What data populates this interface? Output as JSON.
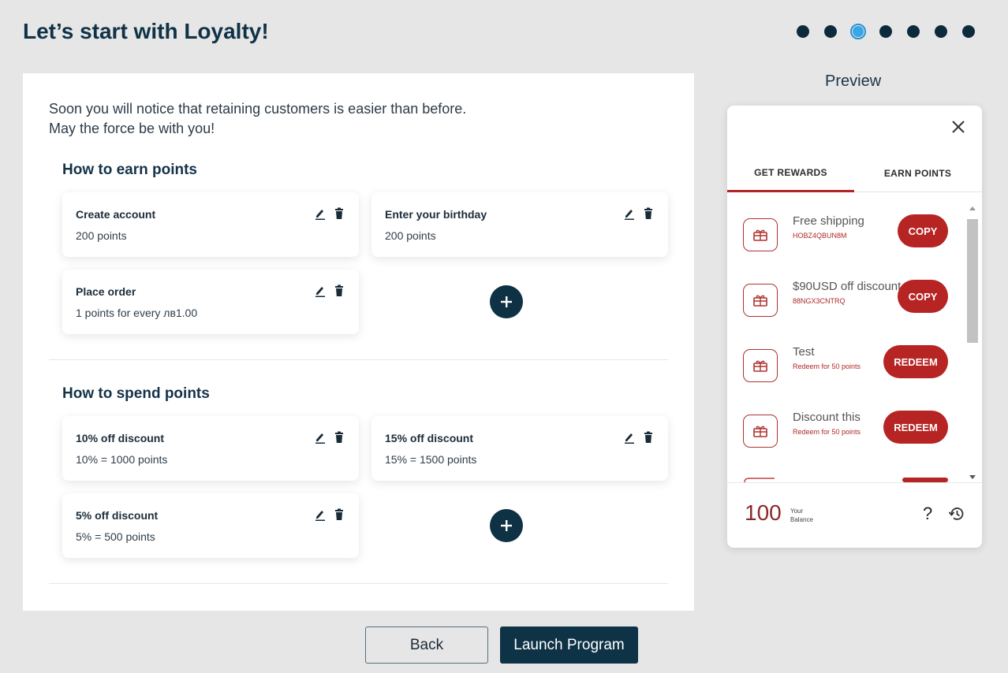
{
  "header": {
    "title": "Let’s start with Loyalty!",
    "steps_total": 7,
    "steps_active": 3
  },
  "main": {
    "intro_line1": "Soon you will notice that retaining customers is easier than before.",
    "intro_line2": "May the force be with you!",
    "earn": {
      "title": "How to earn points",
      "items": [
        {
          "name": "Create account",
          "value": "200 points"
        },
        {
          "name": "Enter your birthday",
          "value": "200 points"
        },
        {
          "name": "Place order",
          "value": "1 points for every лв1.00"
        }
      ]
    },
    "spend": {
      "title": "How to spend points",
      "items": [
        {
          "name": "10% off discount",
          "value": "10% = 1000 points"
        },
        {
          "name": "15% off discount",
          "value": "15% = 1500 points"
        },
        {
          "name": "5% off discount",
          "value": "5% = 500 points"
        }
      ]
    }
  },
  "buttons": {
    "back": "Back",
    "launch": "Launch Program"
  },
  "preview": {
    "label": "Preview",
    "tabs": [
      "GET REWARDS",
      "EARN POINTS"
    ],
    "active_tab": "GET REWARDS",
    "rewards": [
      {
        "name": "Free shipping",
        "code": "HOBZ4QBUN8M",
        "action": "COPY"
      },
      {
        "name": "$90USD off discount",
        "code": "88NGX3CNTRQ",
        "action": "COPY"
      },
      {
        "name": "Test",
        "code": "Redeem for 50 points",
        "action": "REDEEM"
      },
      {
        "name": "Discount this",
        "code": "Redeem for 50 points",
        "action": "REDEEM"
      }
    ],
    "balance_value": "100",
    "balance_label_1": "Your",
    "balance_label_2": "Balance",
    "help": "?"
  },
  "colors": {
    "navy": "#0e3246",
    "accent_red": "#b72424",
    "step_active": "#35a6e8"
  }
}
